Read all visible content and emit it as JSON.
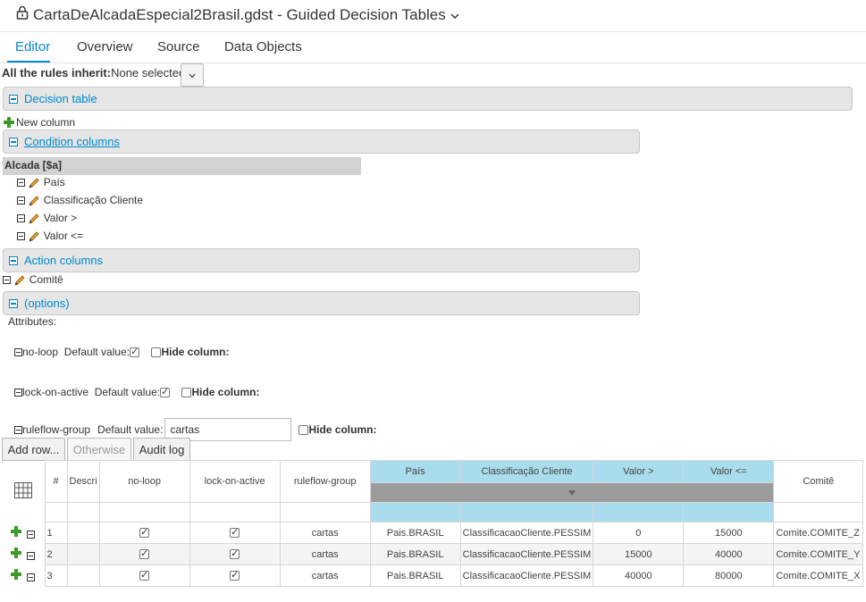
{
  "header": {
    "title": "CartaDeAlcadaEspecial2Brasil.gdst - Guided Decision Tables"
  },
  "tabs": [
    {
      "label": "Editor"
    },
    {
      "label": "Overview"
    },
    {
      "label": "Source"
    },
    {
      "label": "Data Objects"
    }
  ],
  "inherit": {
    "label": "All the rules inherit:",
    "value": "None selected"
  },
  "panels": {
    "decision_table": "Decision table",
    "condition_columns": "Condition columns",
    "action_columns": "Action columns",
    "options": "(options)"
  },
  "new_column": "New column",
  "pattern": "Alcada [$a]",
  "conditions": [
    "País",
    "Classificação Cliente",
    "Valor >",
    "Valor <="
  ],
  "actions": [
    "Comitê"
  ],
  "attributes": {
    "title": "Attributes:",
    "default_label": "Default value:",
    "hide_label": "Hide column:",
    "items": [
      {
        "name": "no-loop",
        "default_checked": true
      },
      {
        "name": "lock-on-active",
        "default_checked": true
      },
      {
        "name": "ruleflow-group",
        "default_value": "cartas"
      }
    ]
  },
  "toolbar": {
    "add_row": "Add row...",
    "otherwise": "Otherwise",
    "audit_log": "Audit log"
  },
  "grid": {
    "headers": [
      "#",
      "Descri",
      "no-loop",
      "lock-on-active",
      "ruleflow-group",
      "País",
      "Classificação Cliente",
      "Valor >",
      "Valor <=",
      "Comitê"
    ],
    "rows": [
      {
        "num": "1",
        "noloop": true,
        "lock": true,
        "ruleflow": "cartas",
        "pais": "Pais.BRASIL",
        "classif": "ClassificacaoCliente.PESSIM",
        "vmin": "0",
        "vmax": "15000",
        "comite": "Comite.COMITE_Z"
      },
      {
        "num": "2",
        "noloop": true,
        "lock": true,
        "ruleflow": "cartas",
        "pais": "Pais.BRASIL",
        "classif": "ClassificacaoCliente.PESSIM",
        "vmin": "15000",
        "vmax": "40000",
        "comite": "Comite.COMITE_Y"
      },
      {
        "num": "3",
        "noloop": true,
        "lock": true,
        "ruleflow": "cartas",
        "pais": "Pais.BRASIL",
        "classif": "ClassificacaoCliente.PESSIM",
        "vmin": "40000",
        "vmax": "80000",
        "comite": "Comite.COMITE_X"
      }
    ]
  },
  "colors": {
    "accent": "#0088ce",
    "condition_bg": "#d2eef8",
    "condition_header_bg": "#a9dcec",
    "panel_bg": "#e6e6e6",
    "plus_green": "#3c9a28"
  },
  "icons": [
    "lock-icon",
    "chevron-down-icon",
    "plus-icon",
    "pencil-icon",
    "minus-icon",
    "grid-layout-icon",
    "sort-arrow-icon"
  ]
}
